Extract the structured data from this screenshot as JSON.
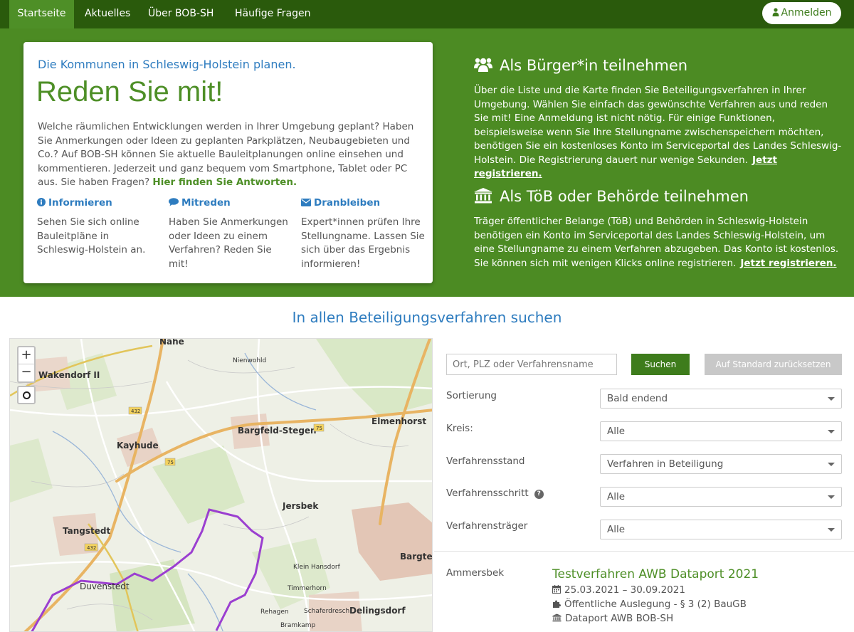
{
  "nav": {
    "items": [
      "Startseite",
      "Aktuelles",
      "Über BOB-SH",
      "Häufige Fragen"
    ],
    "login": "Anmelden"
  },
  "hero": {
    "kicker": "Die Kommunen in Schleswig-Holstein planen.",
    "title": "Reden Sie mit!",
    "intro": "Welche räumlichen Entwicklungen werden in Ihrer Umgebung geplant? Haben Sie Anmerkungen oder Ideen zu geplanten Parkplätzen, Neubaugebieten und Co.? Auf BOB-SH können Sie aktuelle Bauleitplanungen online einsehen und kommentieren. Jederzeit und ganz bequem vom Smartphone, Tablet oder PC aus. Sie haben Fragen?",
    "intro_link": "Hier finden Sie Antworten.",
    "features": [
      {
        "title": "Informieren",
        "icon": "info-icon",
        "text": "Sehen Sie sich online Bauleitpläne in Schleswig-Holstein an."
      },
      {
        "title": "Mitreden",
        "icon": "comment-icon",
        "text": "Haben Sie Anmerkungen oder Ideen zu einem Verfahren? Reden Sie mit!"
      },
      {
        "title": "Dranbleiben",
        "icon": "envelope-icon",
        "text": "Expert*innen prüfen Ihre Stellungname. Lassen Sie sich über das Ergebnis informieren!"
      }
    ],
    "citizen": {
      "title": "Als Bürger*in teilnehmen",
      "icon": "users-icon",
      "text": "Über die Liste und die Karte finden Sie Beteiligungsverfahren in Ihrer Umgebung. Wählen Sie einfach das gewünschte Verfahren aus und reden Sie mit! Eine Anmeldung ist nicht nötig. Für einige Funktionen, beispielsweise wenn Sie Ihre Stellungname zwischenspeichern möchten, benötigen Sie ein kostenloses Konto im Serviceportal des Landes Schleswig-Holstein. Die Registrierung dauert nur wenige Sekunden.",
      "link": "Jetzt registrieren."
    },
    "authority": {
      "title": "Als TöB oder Behörde teilnehmen",
      "icon": "institution-icon",
      "text": "Träger öffentlicher Belange (TöB) und Behörden in Schleswig-Holstein benötigen ein Konto im Serviceportal des Landes Schleswig-Holstein, um eine Stellungname zu einem Verfahren abzugeben. Das Konto ist kostenlos. Sie können sich mit wenigen Klicks online registrieren.",
      "link": "Jetzt registrieren."
    }
  },
  "search": {
    "title": "In allen Beteiligungsverfahren suchen",
    "placeholder": "Ort, PLZ oder Verfahrensname",
    "search_button": "Suchen",
    "reset_button": "Auf Standard zurücksetzen",
    "filters": [
      {
        "label": "Sortierung",
        "value": "Bald endend"
      },
      {
        "label": "Kreis:",
        "value": "Alle"
      },
      {
        "label": "Verfahrensstand",
        "value": "Verfahren in Beteiligung"
      },
      {
        "label": "Verfahrensschritt",
        "value": "Alle"
      },
      {
        "label": "Verfahrensträger",
        "value": "Alle"
      }
    ]
  },
  "map": {
    "zoom_in": "+",
    "zoom_out": "−",
    "places": [
      "Nahe",
      "Wakendorf II",
      "Nienwohld",
      "Kayhude",
      "Bargfeld-Stegen",
      "Elmenhorst",
      "Jersbek",
      "Tangstedt",
      "Klein Hansdorf",
      "Timmerhorn",
      "Bargteh",
      "Duvenstedt",
      "Rehagen",
      "Schaferdresch",
      "Delingsdorf",
      "Bramkamp"
    ],
    "road_numbers": [
      "432",
      "75",
      "75",
      "432"
    ]
  },
  "result": {
    "kreis": "Ammersbek",
    "title": "Testverfahren AWB Dataport 2021",
    "date": "25.03.2021 – 30.09.2021",
    "step": "Öffentliche Auslegung - § 3 (2) BauGB",
    "owner": "Dataport AWB BOB-SH"
  },
  "colors": {
    "nav_bg": "#2a5a0c",
    "hero_bg": "#4c8b23",
    "accent_green": "#4e8f27",
    "link_blue": "#2e7cbf",
    "reset_gray": "#c8c8c8"
  }
}
